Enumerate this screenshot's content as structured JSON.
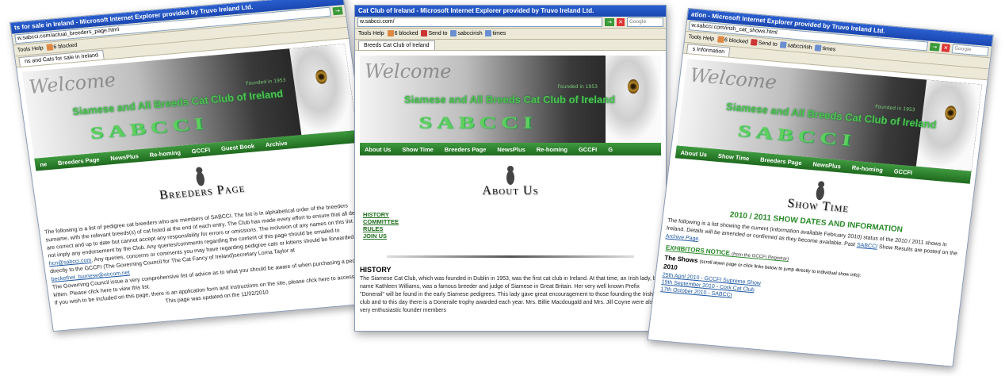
{
  "left": {
    "title_bar": "ts for sale in Ireland - Microsoft Internet Explorer provided by Truvo Ireland Ltd.",
    "address": "w.sabcci.com/actual_breeders_page.html",
    "menu": "Tools  Help",
    "toolbar_blocked": "6 blocked",
    "toolbar_sendto": "Send to",
    "toolbar_bm1": "sabccirish",
    "toolbar_bm2": "times",
    "tab": "ns and Cats for sale in Ireland",
    "welcome": "Welcome",
    "club_name": "Siamese and All Breeds Cat Club of Ireland",
    "sabcci": "SABCCI",
    "founded": "Founded in 1953",
    "nav": [
      "ne",
      "Breeders Page",
      "NewsPlus",
      "Re-homing",
      "GCCFI",
      "Guest Book",
      "Archive"
    ],
    "heading": "Breeders Page",
    "para1": "The following is a list of pedigree cat breeders who are members of SABCCI. The list is in alphabetical order of the breeders surname, with the relevant breeds(s) of cat listed at the end of each entry. The Club has made every effort to ensure that all details are correct and up to date but cannot accept any responsibility for errors or omissions. The inclusion of any names on this list does not imply any endorsement by the Club. Any queries/comments regarding the content of this page should be emailed to",
    "para1_link": "hcn@sabcci.com",
    "para1b": "Any queries, concerns or comments you may have regarding pedigree cats or kittens should be forwarded directly to the GCCFI (The Governing Council for The Cat Fancy of Ireland)secretary Lorna Taylor at",
    "para1b_link": "beckethet_burnese@eircom.net",
    "para2": "The Governing Council issue a very comprehensive list of advice as to what you should be aware of when purchasing a pedigree kitten. Please click here to view this list.",
    "para3": "If you wish to be included on this page, there is an application form and instructions on the site, please click here to access it.",
    "para4": "This page was updated on the 11/02/2010"
  },
  "mid": {
    "title_bar": "Cat Club of Ireland - Microsoft Internet Explorer provided by Truvo Ireland Ltd.",
    "address": "w.sabcci.com/",
    "menu": "Tools  Help",
    "toolbar_blocked": "6 blocked",
    "toolbar_sendto": "Send to",
    "toolbar_bm1": "sabccirish",
    "toolbar_bm2": "times",
    "search_placeholder": "Google",
    "tab": "Breeds Cat Club of Ireland",
    "welcome": "Welcome",
    "club_name": "Siamese and All Breeds Cat Club of Ireland",
    "sabcci": "SABCCI",
    "founded": "Founded in 1953",
    "nav": [
      "About Us",
      "Show Time",
      "Breeders Page",
      "NewsPlus",
      "Re-homing",
      "GCCFI",
      "G"
    ],
    "heading": "About Us",
    "links": [
      "HISTORY",
      "COMMITTEE",
      "RULES",
      "JOIN US"
    ],
    "section_head": "HISTORY",
    "para": "The Siamese Cat Club, which was founded in Dublin in 1953, was the first cat club in Ireland. At that time, an Irish lady, by name Kathleen Williams, was a famous breeder and judge of Siamese in Great Britain. Her very well known Prefix \"Donerail\" will be found in the early Siamese pedigrees. This lady gave great encouragement to those founding the Irish club and to this day there is a Doneraile trophy awarded each year. Mrs. Billie Macdougald and Mrs. Jill Coyne were also very enthusiastic founder members"
  },
  "right": {
    "title_bar": "ation - Microsoft Internet Explorer provided by Truvo Ireland Ltd.",
    "address": "w.sabcci.com/irish_cat_shows.html",
    "menu": "Tools  Help",
    "toolbar_blocked": "6 blocked",
    "toolbar_sendto": "Send to",
    "toolbar_bm1": "sabccirish",
    "toolbar_bm2": "times",
    "search_placeholder": "Google",
    "tab": "s Information",
    "welcome": "Welcome",
    "club_name": "Siamese and All Breeds Cat Club of Ireland",
    "sabcci": "SABCCI",
    "founded": "Founded in 1953",
    "nav": [
      "About Us",
      "Show Time",
      "Breeders Page",
      "NewsPlus",
      "Re-homing",
      "GCCFI"
    ],
    "heading": "Show Time",
    "green_head": "2010 / 2011 SHOW DATES AND INFORMATION",
    "para": "The following is a list showing the current (information available February 2010) status of the 2010 / 2011 shows in Ireland. Details will be amended or confirmed as they become available. Past",
    "para_link1": "SABCCI",
    "para_tail": "Show Results are posted on the",
    "para_link2": "Archive Page",
    "exhibitors": "EXHIBITORS NOTICE",
    "exhibitors_note": "(from the GCCFI Registrar)",
    "shows_label": "The Shows",
    "shows_note": "(scroll down page or click links below to jump directly to individual show info):",
    "year": "2010",
    "shows": [
      "25th April 2010 - GCCFI Supreme Show",
      "19th September 2010 - Cork Cat Club",
      "17th October 2010 - SABCCI"
    ]
  }
}
